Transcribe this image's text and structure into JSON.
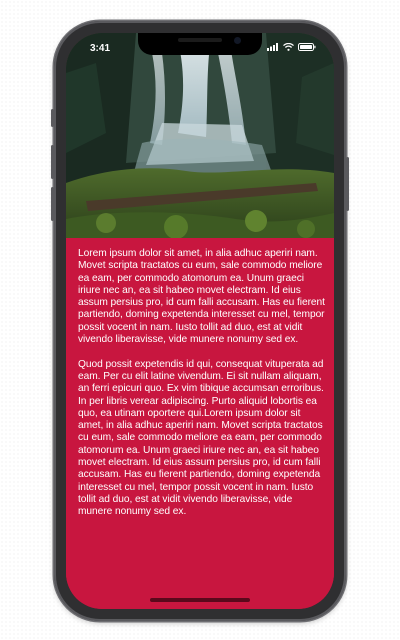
{
  "status_bar": {
    "time": "3:41",
    "signal_icon": "signal-icon",
    "wifi_icon": "wifi-icon",
    "battery_icon": "battery-icon"
  },
  "hero": {
    "image": "waterfall-forest-photo"
  },
  "content": {
    "paragraphs": [
      "Lorem ipsum dolor sit amet, in alia adhuc aperiri nam. Movet scripta tractatos cu eum, sale commodo meliore ea eam, per commodo atomorum ea. Unum graeci iriure nec an, ea sit habeo movet electram. Id eius assum persius pro, id cum falli accusam. Has eu fierent partiendo, doming expetenda interesset cu mel, tempor possit vocent in nam. Iusto tollit ad duo, est at vidit vivendo liberavisse, vide munere nonumy sed ex.",
      "Quod possit expetendis id qui, consequat vituperata ad eam. Per cu elit latine vivendum. Ei sit nullam aliquam, an ferri epicuri quo. Ex vim tibique accumsan erroribus. In per libris verear adipiscing. Purto aliquid lobortis ea quo, ea utinam oportere qui.Lorem ipsum dolor sit amet, in alia adhuc aperiri nam. Movet scripta tractatos cu eum, sale commodo meliore ea eam, per commodo atomorum ea. Unum graeci iriure nec an, ea sit habeo movet electram. Id eius assum persius pro, id cum falli accusam. Has eu fierent partiendo, doming expetenda interesset cu mel, tempor possit vocent in nam. Iusto tollit ad duo, est at vidit vivendo liberavisse, vide munere nonumy sed ex."
    ]
  },
  "colors": {
    "content_background": "#c8163f",
    "text": "#ffffff",
    "device_frame": "#2f2f31"
  }
}
